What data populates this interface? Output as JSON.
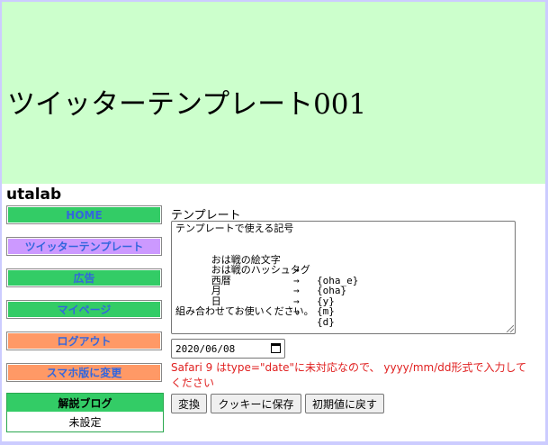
{
  "banner": {
    "title": "ツイッターテンプレート001"
  },
  "site": {
    "name": "utalab"
  },
  "nav": {
    "items": [
      {
        "label": "HOME",
        "bg": "#33cc66",
        "fg": "#3366dd"
      },
      {
        "label": "ツイッターテンプレート",
        "bg": "#cc99ff",
        "fg": "#3366dd"
      },
      {
        "label": "広告",
        "bg": "#33cc66",
        "fg": "#3366dd"
      },
      {
        "label": "マイページ",
        "bg": "#33cc66",
        "fg": "#3366dd"
      },
      {
        "label": "ログアウト",
        "bg": "#ff9966",
        "fg": "#3366dd"
      },
      {
        "label": "スマホ版に変更",
        "bg": "#ff9966",
        "fg": "#3366dd"
      }
    ]
  },
  "blog": {
    "heading": "解説ブログ",
    "value": "未設定"
  },
  "main": {
    "label": "テンプレート",
    "template": {
      "intro": "テンプレートで使える記号",
      "symbols": [
        {
          "name": "おは戦の絵文字",
          "arrow": "→",
          "code": "{oha_e}"
        },
        {
          "name": "おは戦のハッシュタグ",
          "arrow": "→",
          "code": "{oha}"
        },
        {
          "name": "西暦",
          "arrow": "→",
          "code": "{y}"
        },
        {
          "name": "月",
          "arrow": "→",
          "code": "{m}"
        },
        {
          "name": "日",
          "arrow": "→",
          "code": "{d}"
        }
      ],
      "footer": "組み合わせてお使いください。"
    },
    "date_value": "2020/06/08",
    "note": "Safari 9 はtype=\"date\"に未対応なので、 yyyy/mm/dd形式で入力してください",
    "buttons": {
      "convert": "変換",
      "save_cookie": "クッキーに保存",
      "reset": "初期値に戻す"
    }
  },
  "colors": {
    "banner_bg": "#ccffcc",
    "frame_bg": "#ccccff",
    "note": "#e02020"
  }
}
